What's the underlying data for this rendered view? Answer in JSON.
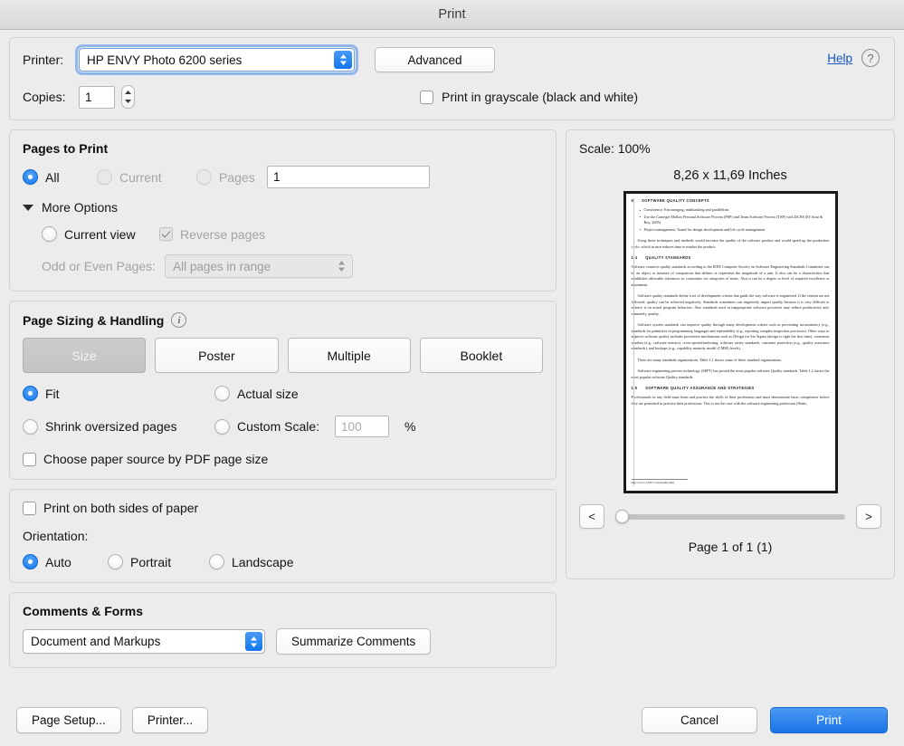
{
  "window": {
    "title": "Print"
  },
  "printer": {
    "label": "Printer:",
    "selected": "HP ENVY Photo 6200 series",
    "advanced_label": "Advanced",
    "help_label": "Help"
  },
  "copies": {
    "label": "Copies:",
    "value": "1",
    "grayscale_label": "Print in grayscale (black and white)",
    "grayscale_checked": false
  },
  "pages_to_print": {
    "title": "Pages to Print",
    "all_label": "All",
    "current_label": "Current",
    "pages_label": "Pages",
    "pages_value": "1",
    "more_options_label": "More Options",
    "current_view_label": "Current view",
    "reverse_pages_label": "Reverse pages",
    "odd_even_label": "Odd or Even Pages:",
    "odd_even_value": "All pages in range",
    "selected": "All"
  },
  "page_sizing": {
    "title": "Page Sizing & Handling",
    "tabs": [
      {
        "label": "Size",
        "active": true
      },
      {
        "label": "Poster",
        "active": false
      },
      {
        "label": "Multiple",
        "active": false
      },
      {
        "label": "Booklet",
        "active": false
      }
    ],
    "fit_label": "Fit",
    "actual_size_label": "Actual size",
    "shrink_label": "Shrink oversized pages",
    "custom_scale_label": "Custom Scale:",
    "custom_scale_value": "100",
    "percent_symbol": "%",
    "paper_source_label": "Choose paper source by PDF page size",
    "selected": "Fit"
  },
  "duplex": {
    "both_sides_label": "Print on both sides of paper",
    "orientation_label": "Orientation:",
    "auto_label": "Auto",
    "portrait_label": "Portrait",
    "landscape_label": "Landscape",
    "selected": "Auto"
  },
  "comments_forms": {
    "title": "Comments & Forms",
    "selected": "Document and Markups",
    "summarize_label": "Summarize Comments"
  },
  "preview": {
    "scale_text": "Scale: 100%",
    "dimensions_text": "8,26 x 11,69 Inches",
    "prev_label": "<",
    "next_label": ">",
    "page_count_text": "Page 1 of 1 (1)",
    "document": {
      "heading_number": "5",
      "heading_text": "SOFTWARE QUALITY CONCEPTS",
      "bullets": [
        "Consistency: Encouraging, multitasking and parallelism",
        "Use the Carnegie Mellon Personal Software Process (PSP) and Team Software Process (TSP) with DCNS (El-Attar & Roy, 2005)",
        "Project management: Tuned for design development and life cycle management"
      ],
      "paragraph_1": "Using these techniques and methods would increase the quality of the software product and would speed up the production cycle, which in turn reduces time to market the product.",
      "section_2_number": "1.4",
      "section_2_title": "QUALITY STANDARDS",
      "section_2_paragraphs": [
        "Software connects quality standards according to the IEEE Computer Society on Software Engineering Standards Committee can be an object or measure of comparison that defines or represents the magnitude of a unit. It also can be a characteristic that establishes allowable tolerances or constraints for categories of items. Also it can be a degree or level of required excellence or attainment.",
        "Software quality standards define a set of development criteria that guide the way software is engineered. If the criteria are not followed, quality can be achieved negatively. Standards sometimes can negatively impact quality because it is very difficult to enforce it on actual program behaviors. Also standards used in inappropriate software processes may reduce productivity and, ultimately, quality.",
        "Software system standards can improve quality through many development criteria such as preventing inconsistency (e.g., standards for primitives in programming languages and repeatability (e.g., reporting complex inspection processes). Other ways to improve software quality includes preventive mechanisms such as Design for Six Sigma (design is right the first time), consensus wisdom (e.g., software metrics), cross-spread/anchoring, software safety standards, customer protection (e.g., quality assurance standards), and backups (e.g., capability maturity model (CMM) levels).",
        "There are many standards organizations. Table 1.1 shows some of these standard organizations.",
        "Software engineering process technology (SEPT) has posted the most popular software Quality standards. Table 1.2 shows the most popular software Quality standards."
      ],
      "section_3_number": "1.5",
      "section_3_title": "SOFTWARE QUALITY ASSURANCE AND STRATEGIES",
      "section_3_paragraph": "Professionals in any field must learn and practice the skills of their professions and must demonstrate basic competence before they are permitted to practice their professions. This is not the case with the software engineering profession (Watts,",
      "footnote": "http://www.12207.com/quality.htm"
    }
  },
  "footer": {
    "page_setup_label": "Page Setup...",
    "printer_label": "Printer...",
    "cancel_label": "Cancel",
    "print_label": "Print"
  },
  "colors": {
    "accent_blue": "#1a74e8",
    "link_blue": "#1557c0",
    "window_bg": "#ececec"
  }
}
